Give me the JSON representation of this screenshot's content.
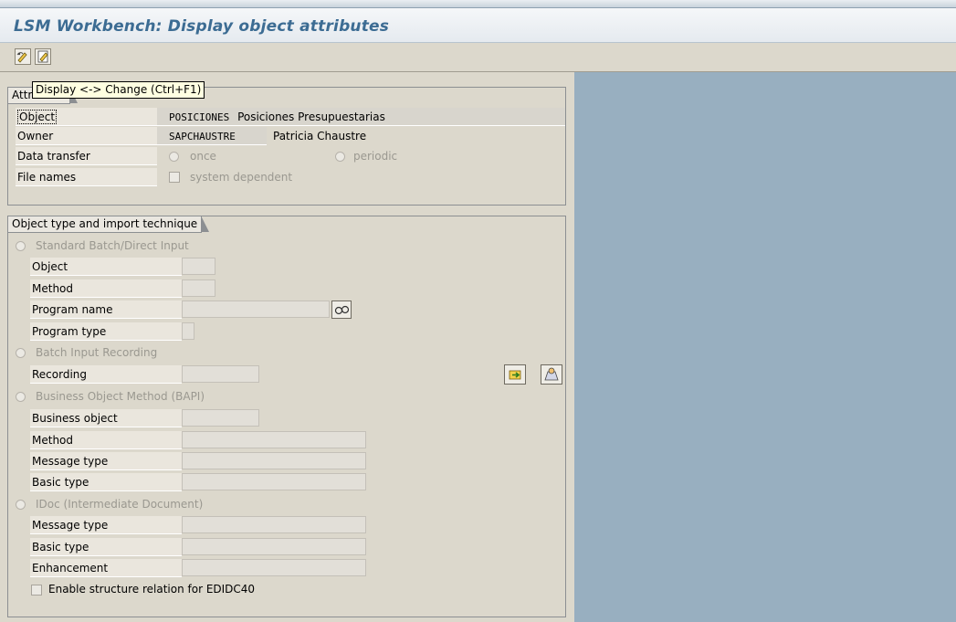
{
  "window": {
    "title": "LSM Workbench: Display object attributes"
  },
  "toolbar": {
    "buttons": [
      {
        "icon": "display-change-icon",
        "tooltip": "Display <-> Change  (Ctrl+F1)"
      },
      {
        "icon": "edit-icon"
      }
    ]
  },
  "attributes": {
    "title": "Attributes",
    "object": {
      "label": "Object",
      "code": "POSICIONES",
      "description": "Posiciones Presupuestarias"
    },
    "owner": {
      "label": "Owner",
      "code": "SAPCHAUSTRE",
      "description": "Patricia Chaustre"
    },
    "data_transfer": {
      "label": "Data transfer",
      "option_once": "once",
      "option_periodic": "periodic"
    },
    "file_names": {
      "label": "File names",
      "checkbox_label": "system dependent"
    }
  },
  "import_technique": {
    "title": "Object type and import technique",
    "standard": {
      "label": "Standard Batch/Direct Input",
      "object_label": "Object",
      "method_label": "Method",
      "program_name_label": "Program name",
      "program_type_label": "Program type"
    },
    "recording": {
      "label": "Batch Input Recording",
      "recording_label": "Recording"
    },
    "bapi": {
      "label": "Business Object Method (BAPI)",
      "business_object_label": "Business object",
      "method_label": "Method",
      "message_type_label": "Message type",
      "basic_type_label": "Basic type"
    },
    "idoc": {
      "label": "IDoc (Intermediate Document)",
      "message_type_label": "Message type",
      "basic_type_label": "Basic type",
      "enhancement_label": "Enhancement"
    },
    "structure_relation_label": "Enable structure relation for EDIDC40"
  }
}
